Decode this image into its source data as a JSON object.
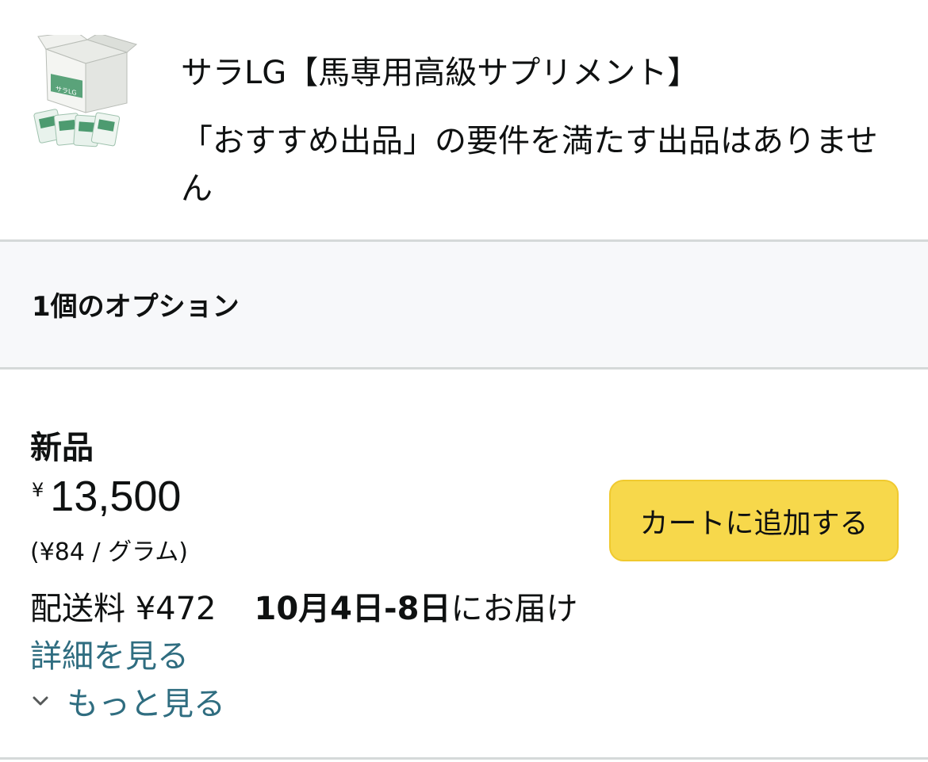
{
  "product": {
    "title": "サラLG【馬専用高級サプリメント】",
    "notice": "「おすすめ出品」の要件を満たす出品はありません",
    "image_label": "サラLG"
  },
  "options": {
    "label": "1個のオプション"
  },
  "offer": {
    "condition": "新品",
    "price_symbol": "¥",
    "price": "13,500",
    "unit_price": "(¥84 / グラム)",
    "shipping_fee": "配送料 ¥472",
    "delivery_date": "10月4日-8日",
    "delivery_suffix": "にお届け",
    "details_link": "詳細を見る",
    "more_link": "もっと見る",
    "add_to_cart": "カートに追加する"
  },
  "colors": {
    "cart_button": "#f7d84b",
    "link": "#2f6d80",
    "section_bg": "#f7f8fa",
    "divider": "#d5d9d9"
  },
  "icons": {
    "more": "chevron-down-icon"
  }
}
